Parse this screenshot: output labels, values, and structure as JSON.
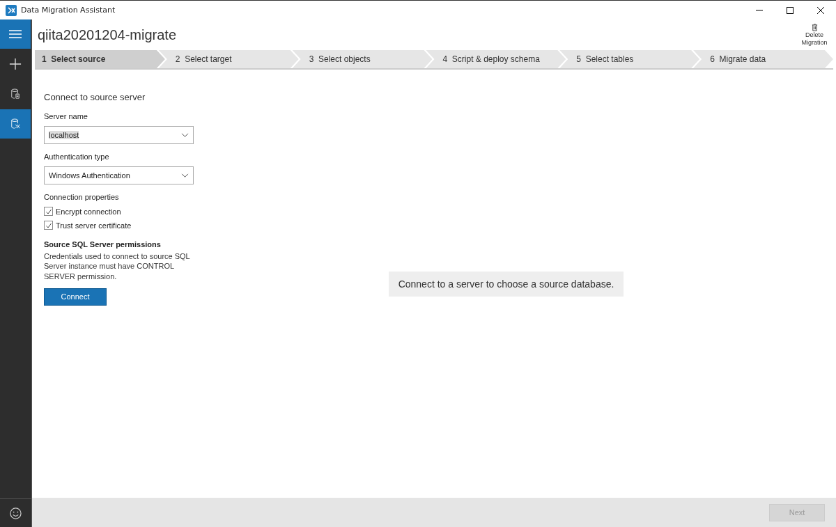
{
  "window": {
    "title": "Data Migration Assistant"
  },
  "sidebar": {
    "items": [
      {
        "kind": "menu",
        "selected": true
      },
      {
        "kind": "new",
        "selected": false
      },
      {
        "kind": "assessment",
        "selected": false
      },
      {
        "kind": "migration",
        "selected": true
      }
    ],
    "footer": {
      "kind": "feedback"
    }
  },
  "project": {
    "title": "qiita20201204-migrate",
    "delete_label": "Delete Migration"
  },
  "steps": [
    {
      "number": "1",
      "label": "Select source",
      "selected": true
    },
    {
      "number": "2",
      "label": "Select target",
      "selected": false
    },
    {
      "number": "3",
      "label": "Select objects",
      "selected": false
    },
    {
      "number": "4",
      "label": "Script & deploy schema",
      "selected": false
    },
    {
      "number": "5",
      "label": "Select tables",
      "selected": false
    },
    {
      "number": "6",
      "label": "Migrate data",
      "selected": false
    }
  ],
  "form": {
    "heading": "Connect to source server",
    "server_name": {
      "label": "Server name",
      "value": "localhost"
    },
    "auth_type": {
      "label": "Authentication type",
      "value": "Windows Authentication"
    },
    "properties_label": "Connection properties",
    "checkboxes": [
      {
        "label": "Encrypt connection",
        "checked": true
      },
      {
        "label": "Trust server certificate",
        "checked": true
      }
    ],
    "permissions_heading": "Source SQL Server permissions",
    "permissions_text": "Credentials used to connect to source SQL Server instance must have CONTROL SERVER permission.",
    "connect_button": "Connect"
  },
  "message": "Connect to a server to choose a source database.",
  "footer": {
    "next_button": {
      "label": "Next",
      "disabled": true
    }
  }
}
